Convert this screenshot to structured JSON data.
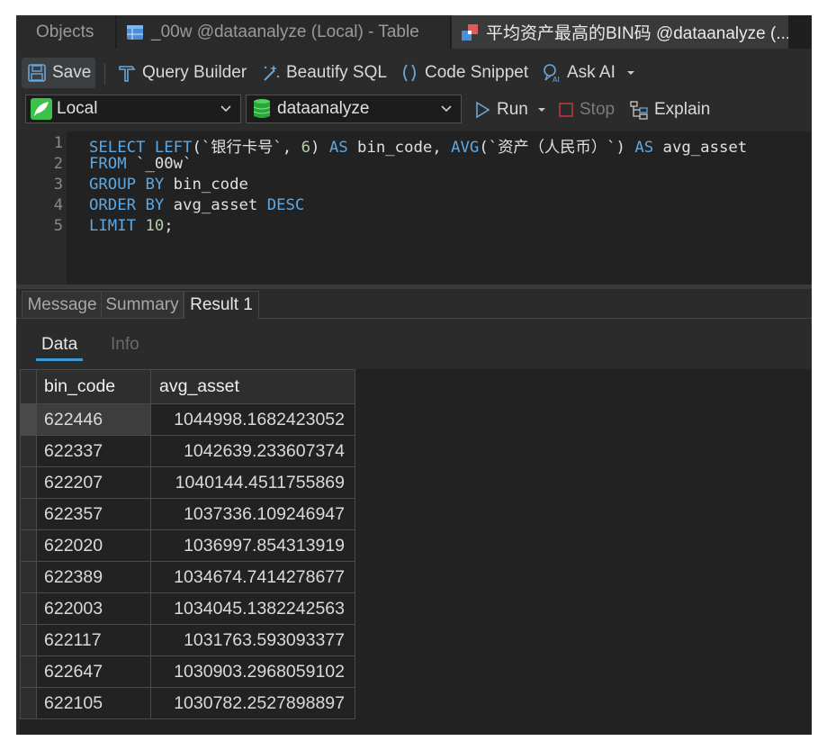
{
  "tabs": [
    {
      "label": "Objects"
    },
    {
      "label": "_00w @dataanalyze (Local) - Table"
    },
    {
      "label": "平均资产最高的BIN码 @dataanalyze (..."
    }
  ],
  "toolbar": {
    "save": "Save",
    "query_builder": "Query Builder",
    "beautify_sql": "Beautify SQL",
    "code_snippet": "Code Snippet",
    "ask_ai": "Ask AI"
  },
  "connection": {
    "server": "Local",
    "database": "dataanalyze",
    "run": "Run",
    "stop": "Stop",
    "explain": "Explain"
  },
  "editor": {
    "line_numbers": [
      "1",
      "2",
      "3",
      "4",
      "5"
    ],
    "lines": [
      [
        {
          "t": "SELECT",
          "k": "kw"
        },
        {
          "t": " "
        },
        {
          "t": "LEFT",
          "k": "kw"
        },
        {
          "t": "(`银行卡号`, "
        },
        {
          "t": "6",
          "k": "num"
        },
        {
          "t": ") "
        },
        {
          "t": "AS",
          "k": "kw"
        },
        {
          "t": " bin_code, "
        },
        {
          "t": "AVG",
          "k": "kw"
        },
        {
          "t": "(`资产（人民币）`) "
        },
        {
          "t": "AS",
          "k": "kw"
        },
        {
          "t": " avg_asset"
        }
      ],
      [
        {
          "t": "FROM",
          "k": "kw"
        },
        {
          "t": " `_00w`"
        }
      ],
      [
        {
          "t": "GROUP",
          "k": "kw"
        },
        {
          "t": " "
        },
        {
          "t": "BY",
          "k": "kw"
        },
        {
          "t": " bin_code"
        }
      ],
      [
        {
          "t": "ORDER",
          "k": "kw"
        },
        {
          "t": " "
        },
        {
          "t": "BY",
          "k": "kw"
        },
        {
          "t": " avg_asset "
        },
        {
          "t": "DESC",
          "k": "kw"
        }
      ],
      [
        {
          "t": "LIMIT",
          "k": "kw"
        },
        {
          "t": " "
        },
        {
          "t": "10",
          "k": "num"
        },
        {
          "t": ";"
        }
      ]
    ]
  },
  "result_tabs": [
    "Message",
    "Summary",
    "Result 1"
  ],
  "sub_tabs": {
    "data": "Data",
    "info": "Info"
  },
  "grid": {
    "columns": [
      "bin_code",
      "avg_asset"
    ],
    "rows": [
      [
        "622446",
        "1044998.1682423052"
      ],
      [
        "622337",
        "1042639.233607374"
      ],
      [
        "622207",
        "1040144.4511755869"
      ],
      [
        "622357",
        "1037336.109246947"
      ],
      [
        "622020",
        "1036997.854313919"
      ],
      [
        "622389",
        "1034674.7414278677"
      ],
      [
        "622003",
        "1034045.1382242563"
      ],
      [
        "622117",
        "1031763.593093377"
      ],
      [
        "622647",
        "1030903.2968059102"
      ],
      [
        "622105",
        "1030782.2527898897"
      ]
    ]
  },
  "colors": {
    "keyword": "#5aa9e6",
    "number": "#b5cea8",
    "accent": "#3a9bd8",
    "background": "#2b2b2b"
  }
}
